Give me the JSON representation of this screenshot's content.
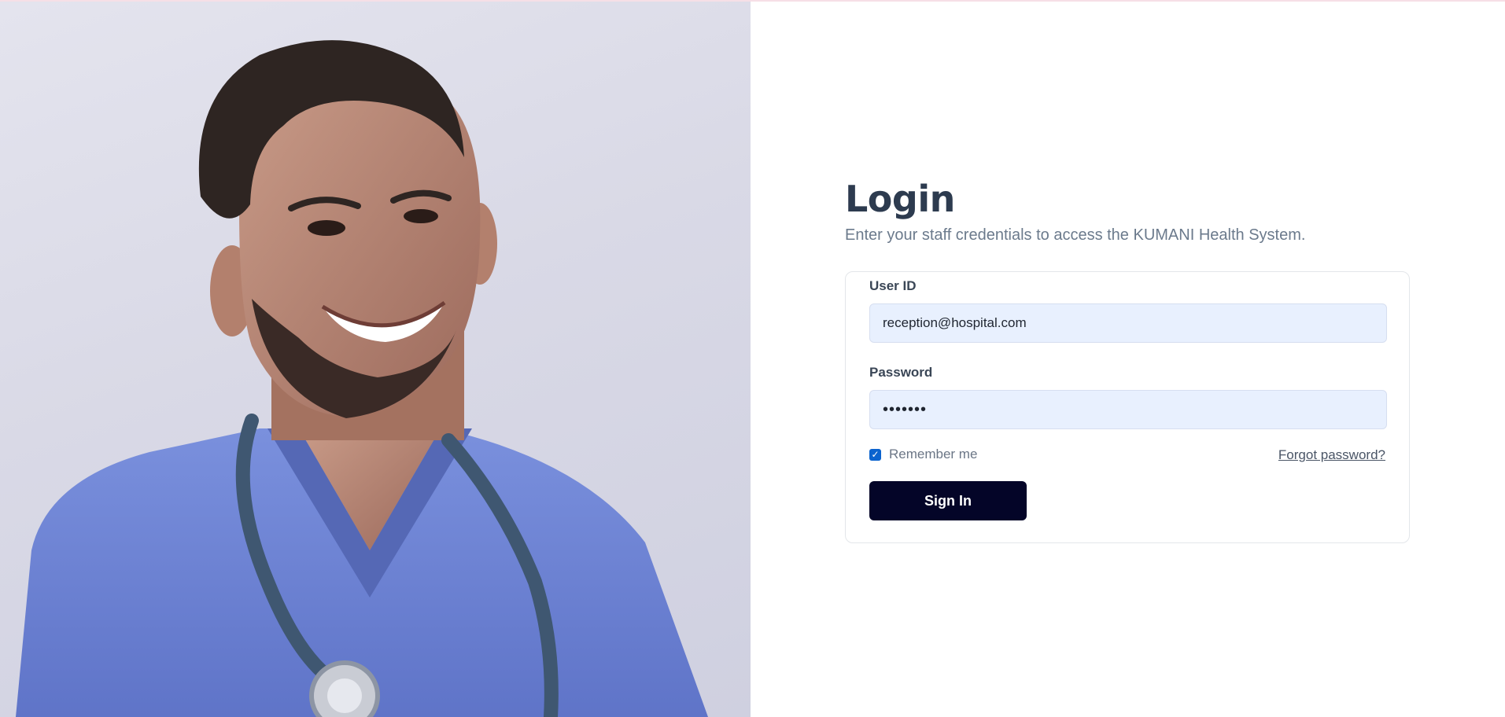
{
  "login": {
    "title": "Login",
    "subtitle": "Enter your staff credentials to access the KUMANI Health System."
  },
  "form": {
    "user_id_label": "User ID",
    "user_id_value": "reception@hospital.com",
    "password_label": "Password",
    "password_value": "•••••••",
    "remember_label": "Remember me",
    "remember_checked": true,
    "forgot_label": "Forgot password?",
    "signin_label": "Sign In"
  },
  "colors": {
    "primary_button": "#040528",
    "heading": "#2d3b4f",
    "input_bg": "#e8f0fe",
    "checkbox": "#0b63ce",
    "scrubs": "#6f86d6"
  },
  "icons": {
    "checkbox": "check-icon"
  }
}
